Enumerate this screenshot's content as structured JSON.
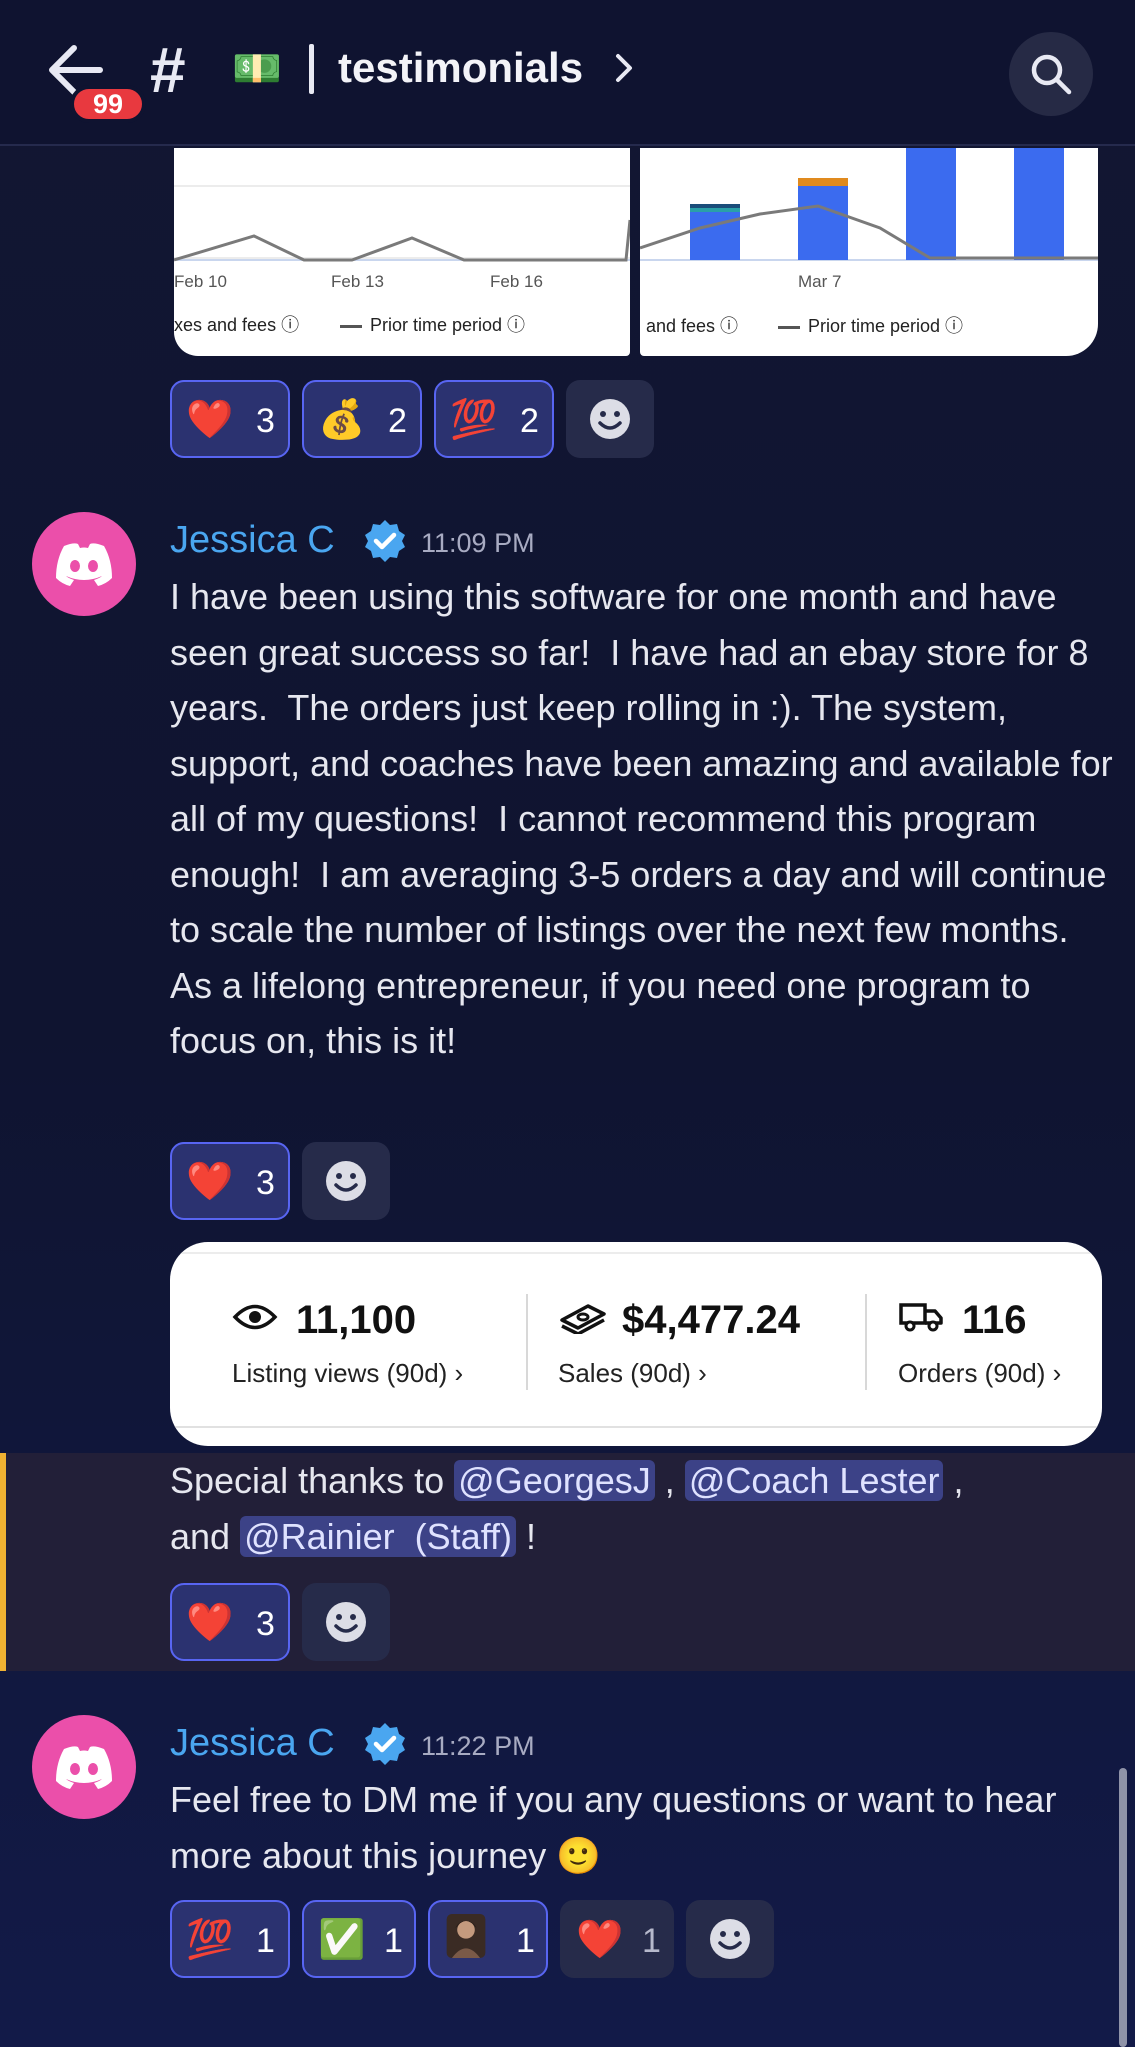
{
  "header": {
    "back_label": "Back",
    "badge": "99",
    "hash": "#",
    "channel_emoji": "💵",
    "channel_name": "testimonials",
    "channel_chevron": "›"
  },
  "chart_images": [
    {
      "x_ticks": [
        "Feb 10",
        "Feb 13",
        "Feb 16"
      ],
      "legend_left": "xes and fees ⓘ",
      "legend_right": "Prior time period ⓘ"
    },
    {
      "x_ticks": [
        "Mar 7"
      ],
      "legend_left": "and fees ⓘ",
      "legend_right": "Prior time period ⓘ"
    }
  ],
  "reactions_row1": [
    {
      "emoji": "❤️",
      "count": "3",
      "active": true
    },
    {
      "emoji": "💰",
      "count": "2",
      "active": true
    },
    {
      "emoji": "💯",
      "count": "2",
      "active": true
    }
  ],
  "message1": {
    "author": "Jessica C",
    "time": "11:09 PM",
    "text": "I have been using this software for one month and have seen great success so far!  I have had an ebay store for 8 years.  The orders just keep rolling in :). The system, support, and coaches have been amazing and available for all of my questions!  I cannot recommend this program enough!  I am averaging 3-5 orders a day and will continue to scale the number of listings over the next few months.  As a lifelong entrepreneur, if you need one program to focus on, this is it!",
    "reactions": [
      {
        "emoji": "❤️",
        "count": "3",
        "active": true
      }
    ]
  },
  "stats_card": {
    "views_value": "11,100",
    "views_label": "Listing views (90d) ›",
    "sales_value": "$4,477.24",
    "sales_label": "Sales (90d) ›",
    "orders_value": "116",
    "orders_label": "Orders (90d) ›"
  },
  "thanks": {
    "prefix": "Special thanks to ",
    "mention1": "@GeorgesJ",
    "sep1": " , ",
    "mention2": "@Coach Lester",
    "sep2": " ,",
    "line2_prefix": "and ",
    "mention3": "@Rainier  (Staff)",
    "suffix": " !",
    "reactions": [
      {
        "emoji": "❤️",
        "count": "3",
        "active": true
      }
    ]
  },
  "message2": {
    "author": "Jessica C",
    "time": "11:22 PM",
    "text": "Feel free to DM me if you any questions or want to hear more about this journey 🙂",
    "reactions": [
      {
        "emoji": "💯",
        "count": "1",
        "active": true
      },
      {
        "emoji": "✅",
        "count": "1",
        "active": true
      },
      {
        "emoji": "avatar-photo",
        "count": "1",
        "active": true
      },
      {
        "emoji": "❤️",
        "count": "1",
        "active": false
      }
    ]
  },
  "colors": {
    "background": "#121633",
    "accent": "#5865f2",
    "author": "#4aa6f0",
    "highlight_bar": "#f0b232",
    "avatar": "#eb4faa",
    "badge": "#e8393f"
  }
}
